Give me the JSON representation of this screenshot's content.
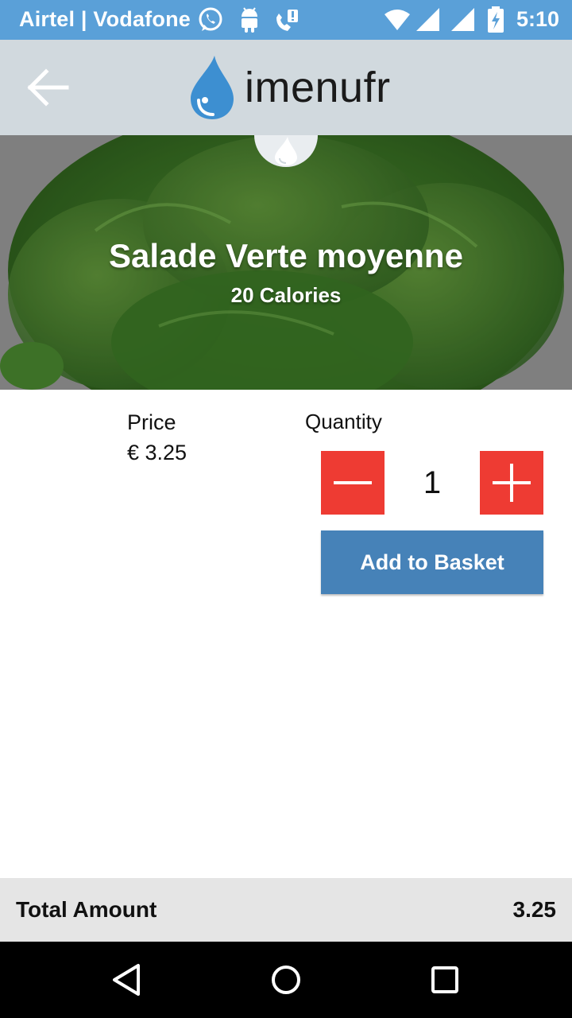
{
  "status_bar": {
    "carrier": "Airtel | Vodafone",
    "time": "5:10",
    "icons": [
      "whatsapp-icon",
      "android-icon",
      "missed-call-icon",
      "wifi-icon",
      "signal-icon",
      "signal-icon",
      "battery-charging-icon"
    ]
  },
  "app_bar": {
    "back_icon": "arrow-left-icon",
    "logo_text": "imenufr"
  },
  "hero": {
    "title": "Salade Verte moyenne",
    "calories": "20 Calories"
  },
  "product": {
    "price_label": "Price",
    "price_value": "€ 3.25",
    "quantity_label": "Quantity",
    "quantity_value": "1",
    "add_button_label": "Add to Basket"
  },
  "footer": {
    "total_label": "Total Amount",
    "total_value": "3.25"
  },
  "colors": {
    "status_bar": "#5aa0d8",
    "app_bar": "#d1d9de",
    "quantity_buttons": "#ee3b33",
    "add_button": "#4682b8",
    "logo_drop": "#3d8fd1",
    "total_bar": "#e5e5e5"
  }
}
